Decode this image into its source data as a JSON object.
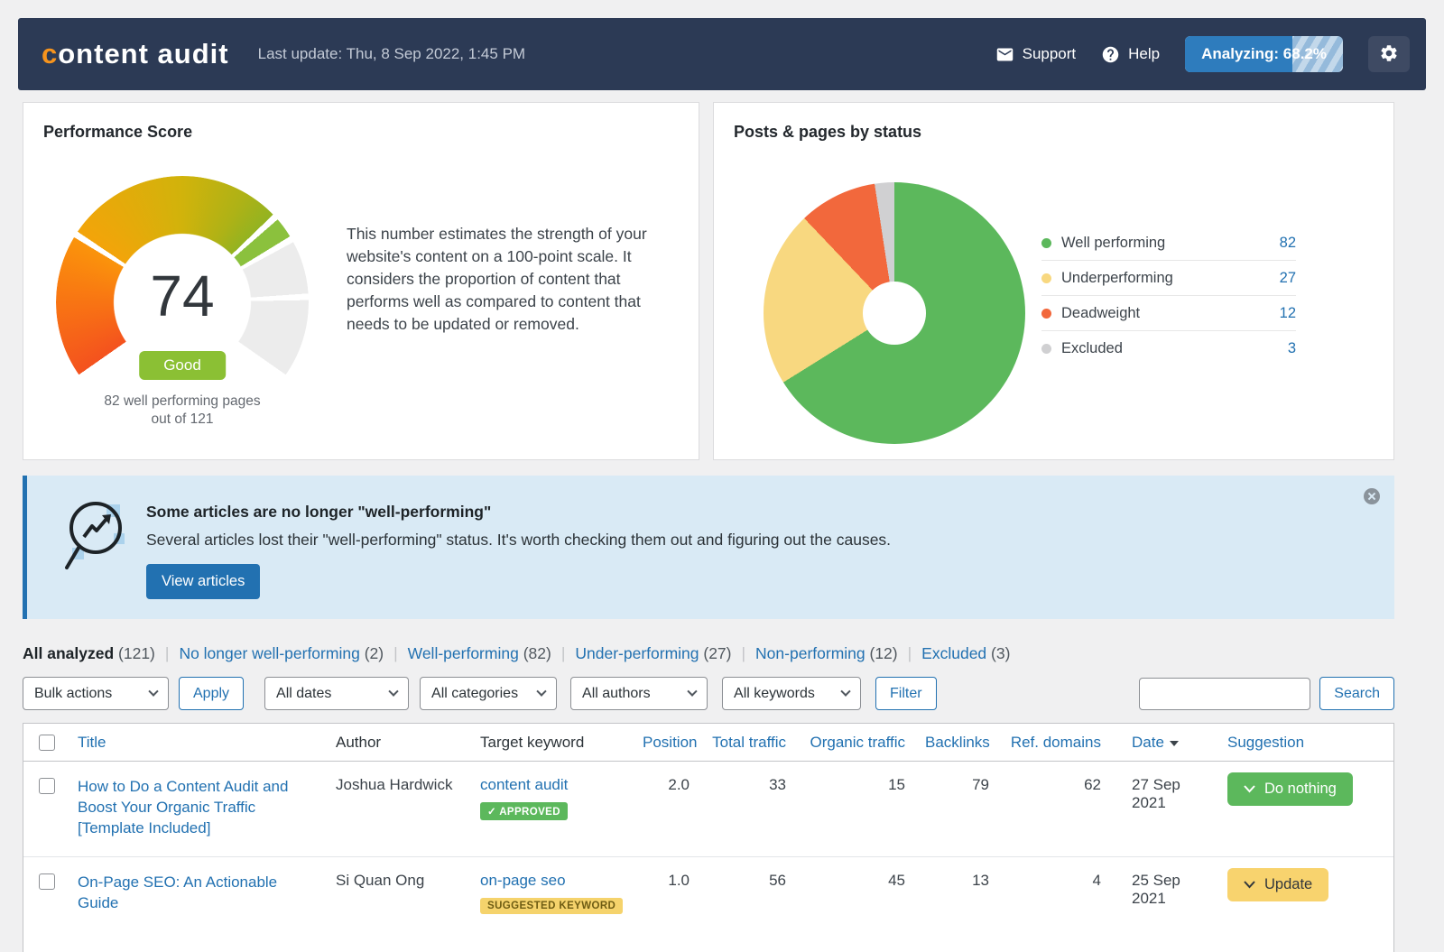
{
  "navbar": {
    "logo_first": "c",
    "logo_rest": "ontent audit",
    "last_update": "Last update: Thu, 8 Sep 2022, 1:45 PM",
    "support_label": "Support",
    "help_label": "Help",
    "analyzing_label": "Analyzing: 68.2%",
    "analyzing_progress_percent": 68.2,
    "colors": {
      "navbar_bg": "#2c3a55",
      "logo_accent": "#f7941d",
      "progress_blue": "#2e7cbd"
    }
  },
  "chart_data": [
    {
      "type": "gauge",
      "title": "Performance Score",
      "value": 74,
      "min": 0,
      "max": 100,
      "sweep_deg": 250,
      "separators_percent": [
        27,
        69,
        85
      ],
      "rating_label": "Good",
      "rating_color": "#8bc034",
      "caption": [
        "82 well performing pages",
        "out of 121"
      ],
      "description": "This number estimates the strength of your website's content on a 100-point scale. It considers the proportion of content that performs well as compared to content that needs to be updated or removed.",
      "colors": {
        "low": "#f4521e",
        "mid": "#d1b30b",
        "high": "#8bc13d",
        "remainder": "#ececec"
      }
    },
    {
      "type": "pie",
      "title": "Posts & pages by status",
      "donut_hole_ratio": 0.24,
      "legend_position": "right",
      "slices": [
        {
          "label": "Well performing",
          "value": 82,
          "color": "#5cb85c"
        },
        {
          "label": "Underperforming",
          "value": 27,
          "color": "#f8d880"
        },
        {
          "label": "Deadweight",
          "value": 12,
          "color": "#f2683c"
        },
        {
          "label": "Excluded",
          "value": 3,
          "color": "#d0d0d2"
        }
      ]
    }
  ],
  "banner": {
    "title": "Some articles are no longer \"well-performing\"",
    "body": "Several articles lost their \"well-performing\" status. It's worth checking them out and figuring out the causes.",
    "button_label": "View articles"
  },
  "tabs": {
    "separator": "|",
    "items": [
      {
        "label": "All analyzed",
        "count": "(121)",
        "active": true
      },
      {
        "label": "No longer well-performing",
        "count": "(2)"
      },
      {
        "label": "Well-performing",
        "count": "(82)"
      },
      {
        "label": "Under-performing",
        "count": "(27)"
      },
      {
        "label": "Non-performing",
        "count": "(12)"
      },
      {
        "label": "Excluded",
        "count": "(3)"
      }
    ]
  },
  "toolbar": {
    "bulk_actions": "Bulk actions",
    "apply_label": "Apply",
    "dates": "All dates",
    "categories": "All categories",
    "authors": "All authors",
    "keywords": "All keywords",
    "filter_label": "Filter",
    "search_value": "",
    "search_button_label": "Search"
  },
  "table": {
    "headers": [
      "Title",
      "Author",
      "Target keyword",
      "Position",
      "Total traffic",
      "Organic traffic",
      "Backlinks",
      "Ref. domains",
      "Date",
      "Suggestion"
    ],
    "sorted_by": "Date",
    "sort_direction": "desc",
    "rows": [
      {
        "title": "How to Do a Content Audit and Boost Your Organic Traffic [Template Included]",
        "author": "Joshua Hardwick",
        "keyword": "content audit",
        "keyword_badge": "✓ APPROVED",
        "position": "2.0",
        "total_traffic": "33",
        "organic_traffic": "15",
        "backlinks": "79",
        "ref_domains": "62",
        "date": "27 Sep 2021",
        "suggestion": "Do nothing"
      },
      {
        "title": "On-Page SEO: An Actionable Guide",
        "author": "Si Quan Ong",
        "keyword": "on-page seo",
        "keyword_badge": "SUGGESTED KEYWORD",
        "position": "1.0",
        "total_traffic": "56",
        "organic_traffic": "45",
        "backlinks": "13",
        "ref_domains": "4",
        "date": "25 Sep 2021",
        "suggestion": "Update"
      }
    ]
  }
}
